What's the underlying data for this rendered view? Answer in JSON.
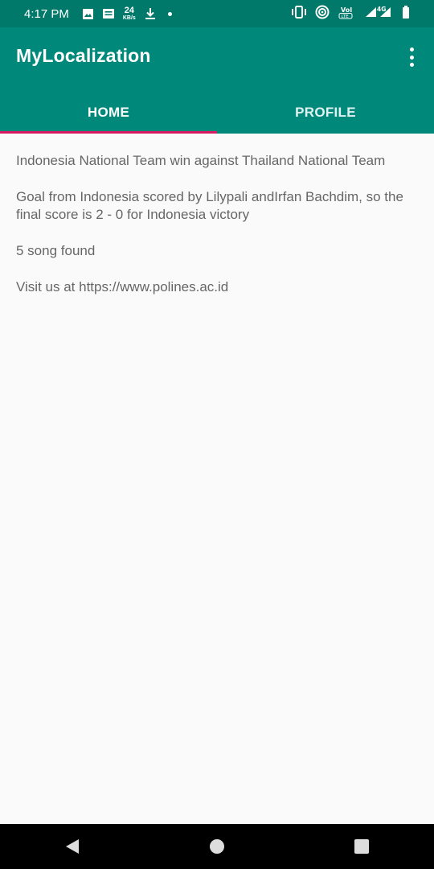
{
  "status_bar": {
    "time": "4:17 PM",
    "speed_value": "24",
    "speed_unit": "KB/s",
    "network": "4G"
  },
  "app": {
    "title": "MyLocalization"
  },
  "tabs": [
    {
      "label": "HOME",
      "selected": true
    },
    {
      "label": "PROFILE",
      "selected": false
    }
  ],
  "content": {
    "headline": "Indonesia National Team win against Thailand National Team",
    "detail": "Goal from Indonesia scored by Lilypali andIrfan Bachdim, so the final score is 2 - 0 for Indonesia victory",
    "songs": "5 song found",
    "visit": "Visit us at https://www.polines.ac.id"
  },
  "colors": {
    "primary": "#00897b",
    "primary_dark": "#00796b",
    "accent": "#d81b60"
  },
  "icons": {
    "status": [
      "image-icon",
      "message-icon",
      "download-icon",
      "vibrate-icon",
      "hotspot-icon",
      "volte-icon",
      "signal-icon",
      "battery-icon"
    ],
    "nav": [
      "back-icon",
      "home-icon",
      "recents-icon"
    ]
  }
}
